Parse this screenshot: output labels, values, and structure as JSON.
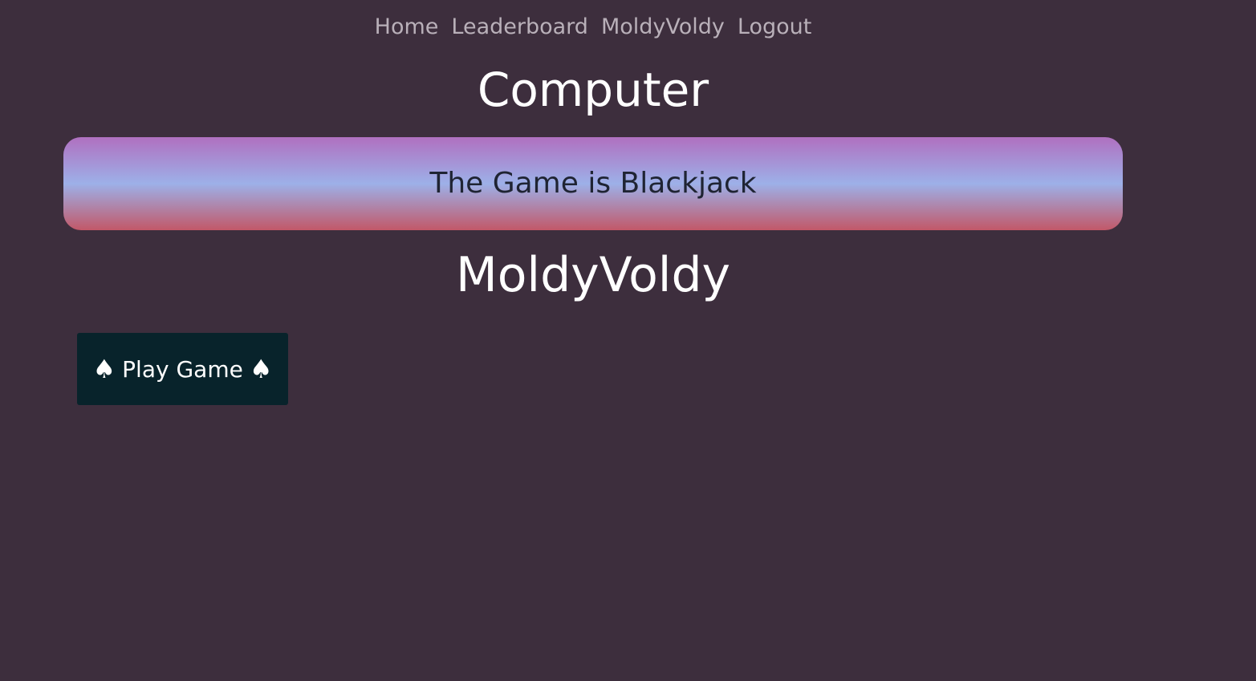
{
  "nav": {
    "items": [
      {
        "label": "Home"
      },
      {
        "label": "Leaderboard"
      },
      {
        "label": "MoldyVoldy"
      },
      {
        "label": "Logout"
      }
    ]
  },
  "computer_heading": "Computer",
  "banner": {
    "text": "The Game is Blackjack",
    "colors": [
      "#b070c0",
      "#9db0e8",
      "#c25868"
    ]
  },
  "player_heading": "MoldyVoldy",
  "play_button": {
    "label": "Play Game",
    "icon": "spade-icon",
    "icon_glyph": "♠"
  },
  "colors": {
    "background": "#3d2e3d",
    "nav_text": "#b9b0b9",
    "button_bg": "#08232b"
  }
}
